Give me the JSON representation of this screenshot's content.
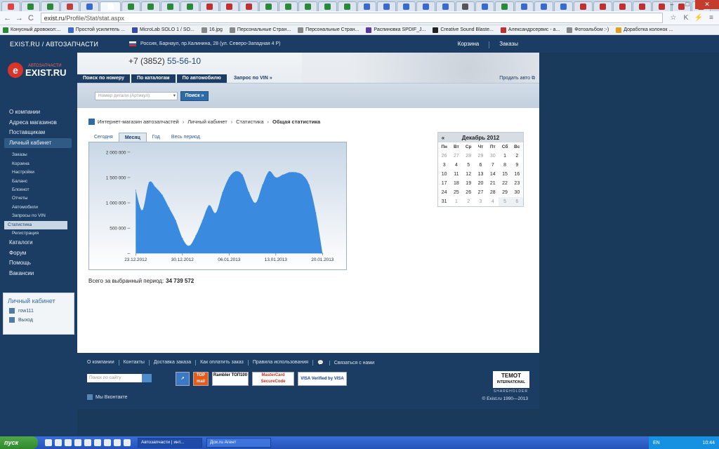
{
  "browser": {
    "url_host": "exist.ru",
    "url_path": "/Profile/Stat/stat.aspx",
    "bookmarks": [
      "Конусный дровокол:...",
      "Простой усилитель ...",
      "MicroLab SOLO 1 / SO...",
      "16.jpg",
      "Персональные Стран...",
      "Персональные Стран...",
      "Распиновка SPDIF_J...",
      "Creative Sound Blaste...",
      "Александрсервис - а...",
      "Фотоальбом :-)",
      "Доработка колонок ..."
    ],
    "tab_colors": [
      "#d44",
      "#2a8a3a",
      "#2a8a3a",
      "#c04040",
      "#3a6ad0",
      "#fff",
      "#2a8a3a",
      "#2a8a3a",
      "#2a8a3a",
      "#2a8a3a",
      "#c03030",
      "#c03030",
      "#c03030",
      "#2a8a3a",
      "#2a8a3a",
      "#2a8a3a",
      "#2a8a3a",
      "#2a8a3a",
      "#3a6ad0",
      "#3a6ad0",
      "#3a6ad0",
      "#3a6ad0",
      "#3a6ad0",
      "#555",
      "#3a6ad0",
      "#2a8a3a",
      "#3a6ad0",
      "#3a6ad0",
      "#3a6ad0",
      "#c03030",
      "#c03030",
      "#c03030",
      "#c03030",
      "#c03030",
      "#c03030",
      "#c03030"
    ],
    "window_controls": [
      "–",
      "□",
      "✕"
    ]
  },
  "site": {
    "title": "EXIST.RU / АВТОЗАПЧАСТИ",
    "region": "Россия, Барнаул, пр.Калинина, 28 (ул. Северо-Западная 4 Р)",
    "topnav": [
      "Корзина",
      "Заказы"
    ],
    "logo_small": "АВТОЗАПЧАСТИ",
    "logo_big": "EXIST.RU",
    "phone_prefix": "+7 (3852)",
    "phone_number": "55-56-10",
    "tabs": [
      "Поиск по номеру",
      "По каталогам",
      "По автомобилю",
      "Запрос по VIN »"
    ],
    "sell_link": "Продать авто",
    "part_placeholder": "Номер детали (Артикул)",
    "search_button": "Поиск »"
  },
  "menu": {
    "items": [
      "О компании",
      "Адреса магазинов",
      "Поставщикам",
      "Личный кабинет"
    ],
    "sub": [
      "Заказы",
      "Корзина",
      "Настройки",
      "Баланс",
      "Блокнот",
      "Отчеты",
      "Автомобили",
      "Запросы по VIN",
      "Статистика",
      "Регистрация"
    ],
    "items2": [
      "Каталоги",
      "Форум",
      "Помощь",
      "Вакансии"
    ],
    "lk_title": "Личный кабинет",
    "lk_user": "row111",
    "lk_exit": "Выход"
  },
  "breadcrumbs": [
    "Интернет-магазин автозапчастей",
    "Личный кабинет",
    "Статистика",
    "Общая статистика"
  ],
  "periods": [
    "Сегодня",
    "Месяц",
    "Год",
    "Весь период"
  ],
  "total_label": "Всего за выбранный период:",
  "total_value": "34 739 572",
  "calendar": {
    "prev": "«",
    "title": "Декабрь 2012",
    "dow": [
      "Пн",
      "Вт",
      "Ср",
      "Чт",
      "Пт",
      "Сб",
      "Вс"
    ],
    "weeks": [
      [
        "26",
        "27",
        "28",
        "29",
        "30",
        "1",
        "2"
      ],
      [
        "3",
        "4",
        "5",
        "6",
        "7",
        "8",
        "9"
      ],
      [
        "10",
        "11",
        "12",
        "13",
        "14",
        "15",
        "16"
      ],
      [
        "17",
        "18",
        "19",
        "20",
        "21",
        "22",
        "23"
      ],
      [
        "24",
        "25",
        "26",
        "27",
        "28",
        "29",
        "30"
      ],
      [
        "31",
        "1",
        "2",
        "3",
        "4",
        "5",
        "6"
      ]
    ]
  },
  "chart_data": {
    "type": "area",
    "x": [
      "23.12.2012",
      "24.12.2012",
      "25.12.2012",
      "26.12.2012",
      "27.12.2012",
      "28.12.2012",
      "29.12.2012",
      "30.12.2012",
      "31.12.2012",
      "01.01.2013",
      "02.01.2013",
      "03.01.2013",
      "04.01.2013",
      "05.01.2013",
      "06.01.2013",
      "07.01.2013",
      "08.01.2013",
      "09.01.2013",
      "10.01.2013",
      "11.01.2013",
      "12.01.2013",
      "13.01.2013",
      "14.01.2013",
      "15.01.2013",
      "16.01.2013",
      "17.01.2013",
      "18.01.2013",
      "19.01.2013",
      "20.01.2013"
    ],
    "values": [
      1250000,
      850000,
      1400000,
      1300000,
      1150000,
      900000,
      650000,
      300000,
      150000,
      350000,
      650000,
      950000,
      800000,
      1200000,
      1500000,
      1620000,
      1550000,
      1200000,
      1000000,
      1350000,
      1620000,
      1500000,
      1550000,
      1600000,
      1600000,
      1550000,
      1350000,
      800000,
      0
    ],
    "xticks": [
      "23.12.2012",
      "30.12.2012",
      "06.01.2013",
      "13.01.2013",
      "20.01.2013"
    ],
    "yticks": [
      "2 000 000",
      "1 500 000",
      "1 000 000",
      "500 000"
    ],
    "ylim": [
      0,
      2000000
    ],
    "color": "#3a8ae0"
  },
  "footer": {
    "links": [
      "О компании",
      "Контакты",
      "Доставка заказа",
      "Как оплатить заказ",
      "Правила использования",
      "Связаться с нами"
    ],
    "search_placeholder": "Поиск по сайту",
    "badges": [
      "TOP mail",
      "Rambler ТОП100",
      "MasterCard SecureCode",
      "VISA Verified by VISA"
    ],
    "temot": "TEMOT",
    "temot_sub": "INTERNATIONAL",
    "temot_sub2": "SHAREHOLDER",
    "vk": "Мы Вконтакте",
    "copyright": "© Exist.ru 1990—2013"
  },
  "taskbar": {
    "start": "пуск",
    "tasks": [
      "Автозапчасти | инт...",
      "Дох.ru Агент"
    ],
    "lang": "EN",
    "time": "10:44"
  }
}
